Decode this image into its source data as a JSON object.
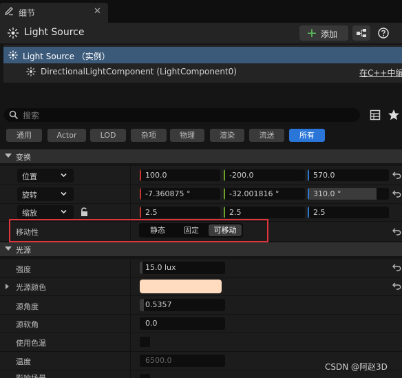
{
  "tab": {
    "title": "细节",
    "icon": "details-icon",
    "close": "✕"
  },
  "header": {
    "title": "Light Source",
    "add_label": "添加",
    "icon": "light-icon"
  },
  "tree": {
    "root_label": "Light Source （实例）",
    "child_label": "DirectionalLightComponent (LightComponent0)",
    "child_link": "在C++中编"
  },
  "search": {
    "placeholder": "搜索"
  },
  "filters": [
    "通用",
    "Actor",
    "LOD",
    "杂项",
    "物理",
    "渲染",
    "流送",
    "所有"
  ],
  "active_filter": "所有",
  "transform": {
    "section_title": "变换",
    "location": {
      "label": "位置",
      "x": "100.0",
      "y": "-200.0",
      "z": "570.0"
    },
    "rotation": {
      "label": "旋转",
      "x": "-7.360875 °",
      "y": "-32.001816 °",
      "z": "310.0 °"
    },
    "scale": {
      "label": "缩放",
      "x": "2.5",
      "y": "2.5",
      "z": "2.5"
    },
    "mobility": {
      "label": "移动性",
      "options": [
        "静态",
        "固定",
        "可移动"
      ],
      "selected": "可移动"
    }
  },
  "light": {
    "section_title": "光源",
    "intensity": {
      "label": "强度",
      "value": "15.0 lux",
      "level": 0.03
    },
    "color": {
      "label": "光源颜色",
      "value": "#ffdcbf"
    },
    "source_angle": {
      "label": "源角度",
      "value": "0.5357",
      "level": 0.05
    },
    "source_soft_angle": {
      "label": "源软角",
      "value": "0.0"
    },
    "use_temperature": {
      "label": "使用色温",
      "checked": false
    },
    "temperature": {
      "label": "温度",
      "value": "6500.0"
    },
    "cast_shadows": {
      "label": "影响场景"
    }
  },
  "watermark": "CSDN @阿赵3D",
  "colors": {
    "accent": "#2a75d8",
    "x_axis": "#c8372f",
    "y_axis": "#6aa527",
    "z_axis": "#2e7ad1",
    "highlight_box": "#e0353d",
    "tree_selected": "#3b5a7a"
  }
}
